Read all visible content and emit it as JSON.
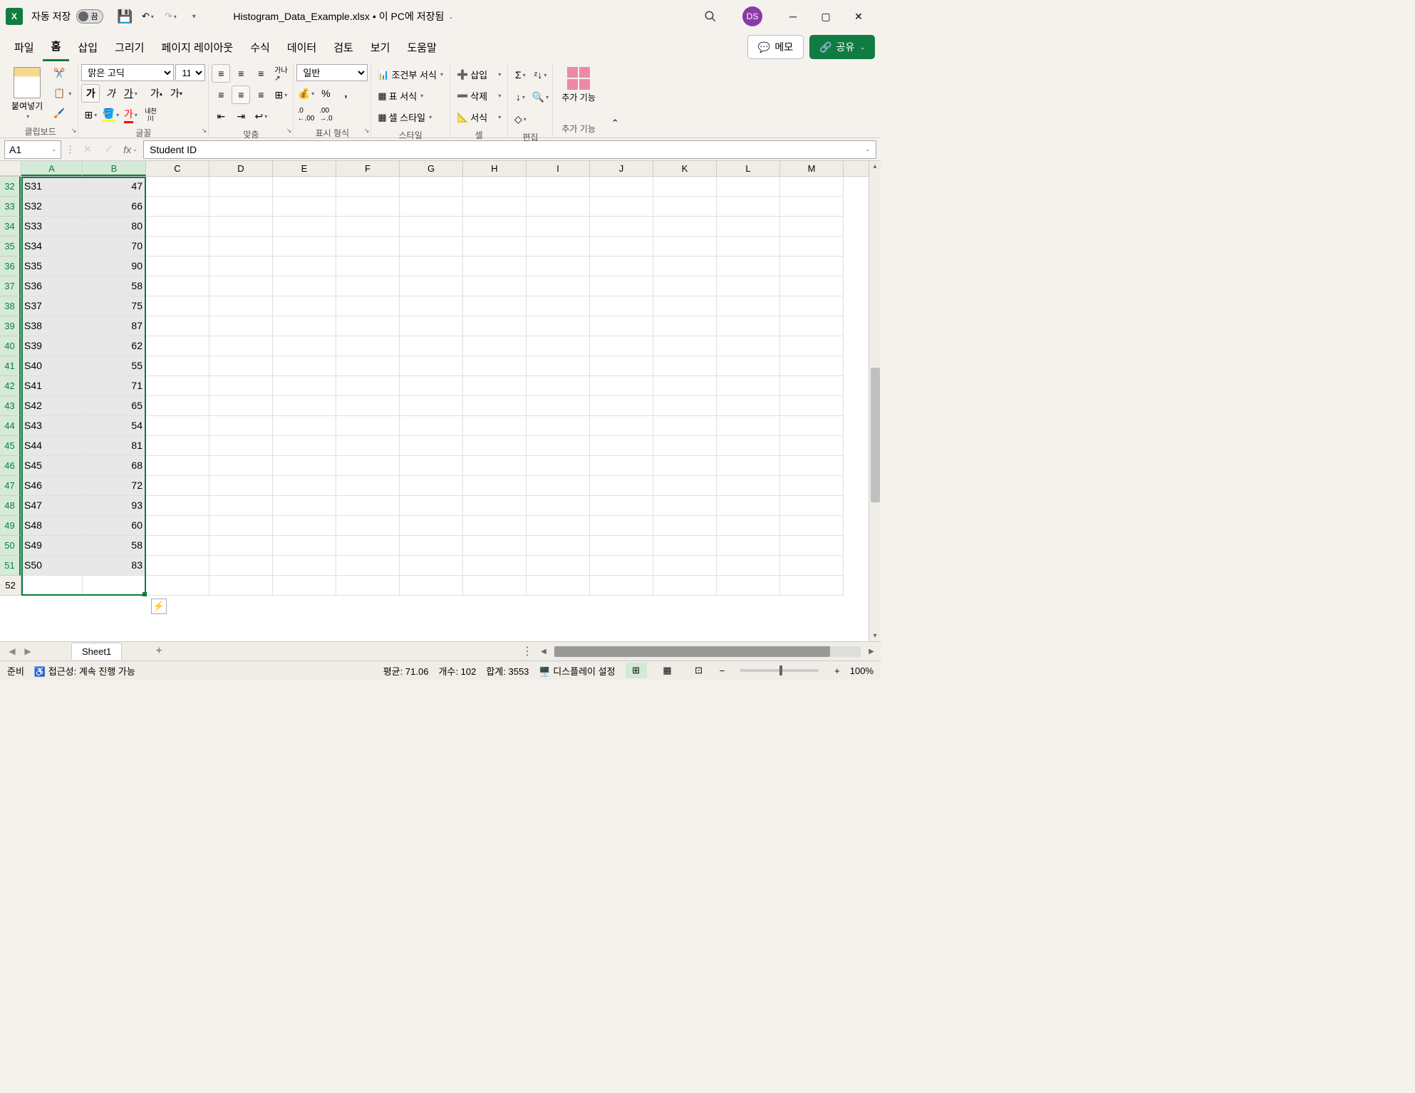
{
  "titlebar": {
    "autosave_label": "자동 저장",
    "autosave_state": "끔",
    "filename": "Histogram_Data_Example.xlsx",
    "save_location": "이 PC에 저장됨",
    "avatar_initials": "DS"
  },
  "tabs": {
    "file": "파일",
    "home": "홈",
    "insert": "삽입",
    "draw": "그리기",
    "page_layout": "페이지 레이아웃",
    "formulas": "수식",
    "data": "데이터",
    "review": "검토",
    "view": "보기",
    "help": "도움말",
    "memo": "메모",
    "share": "공유"
  },
  "ribbon": {
    "paste": "붙여넣기",
    "clipboard": "클립보드",
    "font_name": "맑은 고딕",
    "font_size": "11",
    "font_group": "글꼴",
    "align_group": "맞춤",
    "number_format": "일반",
    "number_group": "표시 형식",
    "conditional": "조건부 서식",
    "table_format": "표 서식",
    "cell_styles": "셀 스타일",
    "styles_group": "스타일",
    "insert": "삽입",
    "delete": "삭제",
    "format": "서식",
    "cells_group": "셀",
    "editing_group": "편집",
    "addins": "추가 기능",
    "addins_group": "추가 기능",
    "hancom": "내천\n川"
  },
  "formula_bar": {
    "name_box": "A1",
    "formula": "Student ID"
  },
  "grid": {
    "columns": [
      "A",
      "B",
      "C",
      "D",
      "E",
      "F",
      "G",
      "H",
      "I",
      "J",
      "K",
      "L",
      "M"
    ],
    "selected_cols": [
      "A",
      "B"
    ],
    "rows": [
      {
        "num": 32,
        "a": "S31",
        "b": 47,
        "sel": true
      },
      {
        "num": 33,
        "a": "S32",
        "b": 66,
        "sel": true
      },
      {
        "num": 34,
        "a": "S33",
        "b": 80,
        "sel": true
      },
      {
        "num": 35,
        "a": "S34",
        "b": 70,
        "sel": true
      },
      {
        "num": 36,
        "a": "S35",
        "b": 90,
        "sel": true
      },
      {
        "num": 37,
        "a": "S36",
        "b": 58,
        "sel": true
      },
      {
        "num": 38,
        "a": "S37",
        "b": 75,
        "sel": true
      },
      {
        "num": 39,
        "a": "S38",
        "b": 87,
        "sel": true
      },
      {
        "num": 40,
        "a": "S39",
        "b": 62,
        "sel": true
      },
      {
        "num": 41,
        "a": "S40",
        "b": 55,
        "sel": true
      },
      {
        "num": 42,
        "a": "S41",
        "b": 71,
        "sel": true
      },
      {
        "num": 43,
        "a": "S42",
        "b": 65,
        "sel": true
      },
      {
        "num": 44,
        "a": "S43",
        "b": 54,
        "sel": true
      },
      {
        "num": 45,
        "a": "S44",
        "b": 81,
        "sel": true
      },
      {
        "num": 46,
        "a": "S45",
        "b": 68,
        "sel": true
      },
      {
        "num": 47,
        "a": "S46",
        "b": 72,
        "sel": true
      },
      {
        "num": 48,
        "a": "S47",
        "b": 93,
        "sel": true
      },
      {
        "num": 49,
        "a": "S48",
        "b": 60,
        "sel": true
      },
      {
        "num": 50,
        "a": "S49",
        "b": 58,
        "sel": true
      },
      {
        "num": 51,
        "a": "S50",
        "b": 83,
        "sel": true
      },
      {
        "num": 52,
        "a": "",
        "b": "",
        "sel": false
      }
    ]
  },
  "sheets": {
    "active": "Sheet1"
  },
  "statusbar": {
    "ready": "준비",
    "accessibility": "접근성: 계속 진행 가능",
    "average_label": "평균:",
    "average": "71.06",
    "count_label": "개수:",
    "count": "102",
    "sum_label": "합계:",
    "sum": "3553",
    "display": "디스플레이 설정",
    "zoom": "100%"
  }
}
